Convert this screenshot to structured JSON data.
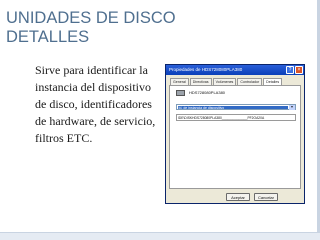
{
  "slide": {
    "title_line1": "UNIDADES DE DISCO",
    "title_line2": "DETALLES",
    "body": "Sirve para identificar la instancia del  dispositivo de disco, identificadores de hardware, de servicio, filtros  ETC."
  },
  "dialog": {
    "title": "Propiedades de HDS728080PLA380",
    "help_label": "?",
    "close_label": "×",
    "tabs": [
      "General",
      "Directivas",
      "Volúmenes",
      "Controlador",
      "Detalles"
    ],
    "active_tab": "Detalles",
    "device_name": "HDS728080PLA380",
    "property_selected": "Id. de instancia de dispositivo",
    "dropdown_arrow": "▼",
    "property_value": "IDE\\DISKHDS728080PLA380______________PF2OA20A",
    "buttons": {
      "accept": "Aceptar",
      "cancel": "Cancelar"
    }
  },
  "colors": {
    "title_color": "#4f6f8f",
    "titlebar": "#0a3fb8",
    "selection": "#316ac5",
    "dialog_bg": "#ece9d8"
  }
}
